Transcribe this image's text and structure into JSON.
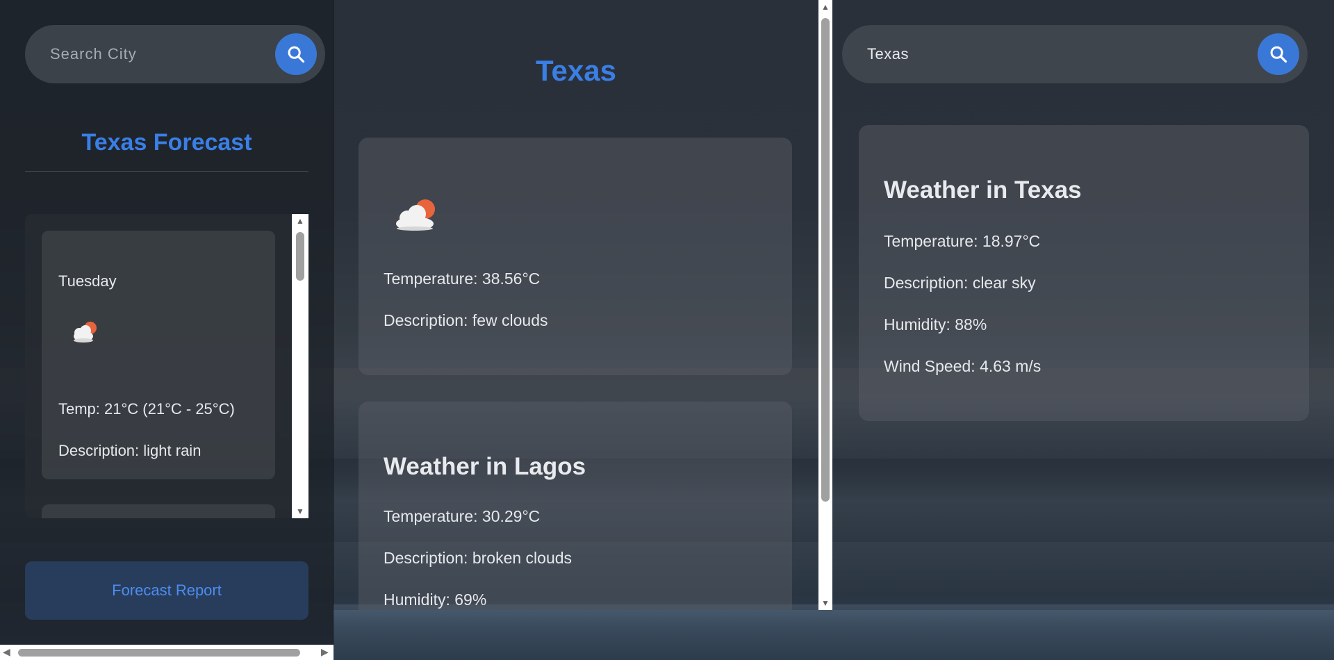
{
  "left_panel": {
    "search": {
      "placeholder": "Search City",
      "icon": "search-icon"
    },
    "title": "Texas Forecast",
    "forecast": [
      {
        "day": "Tuesday",
        "icon": "partly-cloudy-icon",
        "temp": "Temp: 21°C (21°C - 25°C)",
        "description": "Description: light rain"
      }
    ],
    "report_button": "Forecast Report"
  },
  "center_panel": {
    "title": "Texas",
    "current_card": {
      "icon": "partly-cloudy-icon",
      "temperature": "Temperature: 38.56°C",
      "description": "Description: few clouds"
    },
    "city_card": {
      "heading": "Weather in Lagos",
      "temperature": "Temperature: 30.29°C",
      "description": "Description: broken clouds",
      "humidity": "Humidity: 69%"
    }
  },
  "right_panel": {
    "search": {
      "value": "Texas",
      "icon": "search-icon"
    },
    "city_card": {
      "heading": "Weather in Texas",
      "temperature": "Temperature: 18.97°C",
      "description": "Description: clear sky",
      "humidity": "Humidity: 88%",
      "wind": "Wind Speed: 4.63 m/s"
    }
  },
  "colors": {
    "accent": "#3a7fe6",
    "button": "#3a78d8",
    "sun": "#e8643c"
  }
}
